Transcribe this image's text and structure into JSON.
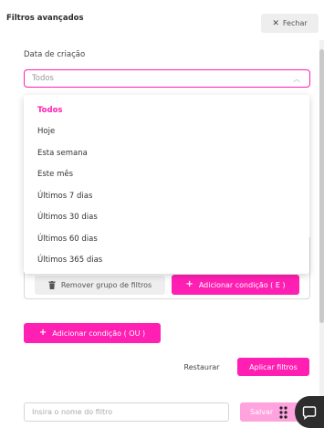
{
  "header": {
    "title": "Filtros avançados",
    "close_label": "Fechar",
    "close_icon": "close-icon"
  },
  "date_filter": {
    "label": "Data de criação",
    "selected_value": "Todos",
    "options": [
      "Todos",
      "Hoje",
      "Esta semana",
      "Este mês",
      "Últimos 7 dias",
      "Últimos 30 dias",
      "Últimos 60 dias",
      "Últimos 365 dias"
    ],
    "selected_index": 0
  },
  "group_actions": {
    "remove_label": "Remover grupo de filtros",
    "add_and_label": "Adicionar condição ( E )"
  },
  "add_or_label": "Adicionar condição ( OU )",
  "footer": {
    "restore_label": "Restaurar",
    "apply_label": "Aplicar filtros",
    "name_placeholder": "Insira o nome do filtro",
    "save_label": "Salvar"
  },
  "colors": {
    "accent": "#ff1fb3",
    "accent_disabled": "#ffa3df",
    "neutral_button": "#eeeeee",
    "chat_bubble": "#2d2d2d"
  }
}
